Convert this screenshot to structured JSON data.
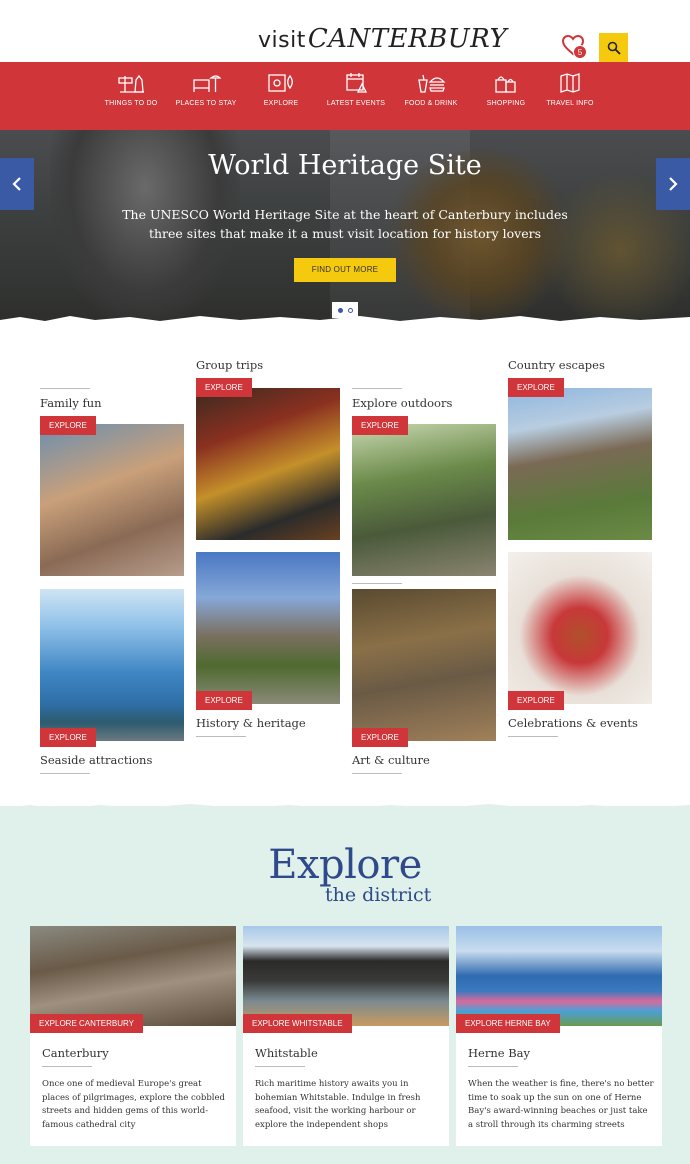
{
  "header": {
    "logo_visit": "visit",
    "logo_canterbury": "CANTERBURY",
    "favourites_count": "5"
  },
  "nav": {
    "items": [
      {
        "label": "THINGS TO DO",
        "icon": "signpost-icon"
      },
      {
        "label": "PLACES TO STAY",
        "icon": "bed-icon"
      },
      {
        "label": "EXPLORE",
        "icon": "map-icon"
      },
      {
        "label": "LATEST EVENTS",
        "icon": "calendar-icon"
      },
      {
        "label": "FOOD & DRINK",
        "icon": "burger-icon"
      },
      {
        "label": "SHOPPING",
        "icon": "shopping-bag-icon"
      },
      {
        "label": "TRAVEL INFO",
        "icon": "folded-map-icon"
      }
    ]
  },
  "hero": {
    "title": "World Heritage Site",
    "text": "The UNESCO World Heritage Site at the heart of Canterbury includes three sites that make it a must visit location for history lovers",
    "button": "FIND OUT MORE"
  },
  "categories": {
    "explore_label": "EXPLORE",
    "tiles": [
      {
        "title": "Family fun"
      },
      {
        "title": "Group trips"
      },
      {
        "title": "Explore outdoors"
      },
      {
        "title": "Country escapes"
      },
      {
        "title": "Seaside attractions"
      },
      {
        "title": "History & heritage"
      },
      {
        "title": "Art & culture"
      },
      {
        "title": "Celebrations & events"
      }
    ]
  },
  "district": {
    "title_main": "Explore",
    "title_sub": "the district",
    "cards": [
      {
        "button": "EXPLORE CANTERBURY",
        "title": "Canterbury",
        "text": "Once one of medieval Europe's great places of pilgrimages, explore the cobbled streets and hidden gems of this world-famous cathedral city"
      },
      {
        "button": "EXPLORE WHITSTABLE",
        "title": "Whitstable",
        "text": "Rich maritime history awaits you in bohemian Whitstable. Indulge in fresh seafood, visit the working harbour or explore the independent shops"
      },
      {
        "button": "EXPLORE HERNE BAY",
        "title": "Herne Bay",
        "text": "When the weather is fine, there's no better time to soak up the sun on one of Herne Bay's award-winning beaches or just take a stroll through its charming streets"
      }
    ]
  },
  "colors": {
    "brand_red": "#d0353a",
    "accent_yellow": "#f4c90e",
    "brand_blue": "#2f4a8a",
    "district_bg": "#dff1ea"
  }
}
